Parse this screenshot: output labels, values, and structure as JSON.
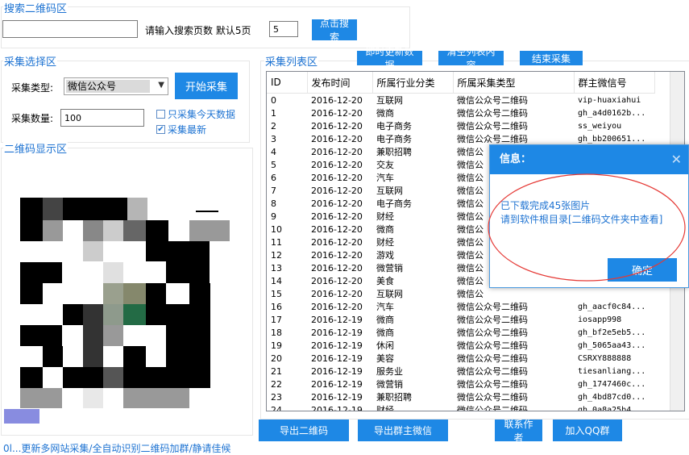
{
  "search_group": {
    "legend": "搜索二维码区",
    "page_hint": "请输入搜索页数 默认5页",
    "pages_value": "5",
    "query_value": "",
    "search_button": "点击搜索"
  },
  "collect_group": {
    "legend": "采集选择区",
    "type_label": "采集类型:",
    "type_value": "微信公众号",
    "start_button": "开始采集",
    "count_label": "采集数量:",
    "count_value": "100",
    "only_today_label": "只采集今天数据",
    "only_today_checked": false,
    "latest_label": "采集最新",
    "latest_checked": true
  },
  "qr_group": {
    "legend": "二维码显示区"
  },
  "list_group": {
    "legend": "采集列表区",
    "buttons": {
      "refresh": "即时更新数据",
      "clear": "清空列表内容",
      "stop": "结束采集"
    },
    "columns": [
      "ID",
      "发布时间",
      "所属行业分类",
      "所属采集类型",
      "群主微信号"
    ],
    "rows": [
      [
        "0",
        "2016-12-20",
        "互联网",
        "微信公众号二维码",
        "vip-huaxiahui"
      ],
      [
        "1",
        "2016-12-20",
        "微商",
        "微信公众号二维码",
        "gh_a4d0162b..."
      ],
      [
        "2",
        "2016-12-20",
        "电子商务",
        "微信公众号二维码",
        "ss_weiyou"
      ],
      [
        "3",
        "2016-12-20",
        "电子商务",
        "微信公众号二维码",
        "gh_bb200651..."
      ],
      [
        "4",
        "2016-12-20",
        "兼职招聘",
        "微信公",
        ""
      ],
      [
        "5",
        "2016-12-20",
        "交友",
        "微信公",
        ""
      ],
      [
        "6",
        "2016-12-20",
        "汽车",
        "微信公",
        ""
      ],
      [
        "7",
        "2016-12-20",
        "互联网",
        "微信公",
        ""
      ],
      [
        "8",
        "2016-12-20",
        "电子商务",
        "微信公",
        ""
      ],
      [
        "9",
        "2016-12-20",
        "财经",
        "微信公",
        ""
      ],
      [
        "10",
        "2016-12-20",
        "微商",
        "微信公",
        ""
      ],
      [
        "11",
        "2016-12-20",
        "财经",
        "微信公",
        ""
      ],
      [
        "12",
        "2016-12-20",
        "游戏",
        "微信公",
        ""
      ],
      [
        "13",
        "2016-12-20",
        "微营销",
        "微信公",
        ""
      ],
      [
        "14",
        "2016-12-20",
        "美食",
        "微信公",
        ""
      ],
      [
        "15",
        "2016-12-20",
        "互联网",
        "微信公",
        ""
      ],
      [
        "16",
        "2016-12-20",
        "汽车",
        "微信公众号二维码",
        "gh_aacf0c84..."
      ],
      [
        "17",
        "2016-12-19",
        "微商",
        "微信公众号二维码",
        "iosapp998"
      ],
      [
        "18",
        "2016-12-19",
        "微商",
        "微信公众号二维码",
        "gh_bf2e5eb5..."
      ],
      [
        "19",
        "2016-12-19",
        "休闲",
        "微信公众号二维码",
        "gh_5065aa43..."
      ],
      [
        "20",
        "2016-12-19",
        "美容",
        "微信公众号二维码",
        "CSRXY888888"
      ],
      [
        "21",
        "2016-12-19",
        "服务业",
        "微信公众号二维码",
        "tiesanliang..."
      ],
      [
        "22",
        "2016-12-19",
        "微营销",
        "微信公众号二维码",
        "gh_1747460c..."
      ],
      [
        "23",
        "2016-12-19",
        "兼职招聘",
        "微信公众号二维码",
        "gh_4bd87cd0..."
      ],
      [
        "24",
        "2016-12-19",
        "财经",
        "微信公众号二维码",
        "gh_0a8a25b4..."
      ]
    ]
  },
  "bottom_buttons": {
    "export_qr": "导出二维码",
    "export_wechat": "导出群主微信",
    "contact": "联系作者",
    "join_qq": "加入QQ群"
  },
  "status_text": "0l...更新多网站采集/全自动识别二维码加群/静请佳候",
  "dialog": {
    "title": "信息：",
    "close_icon": "close-icon",
    "line1": "已下载完成45张图片",
    "line2": "请到软件根目录[二维码文件夹中查看]",
    "ok_button": "确定"
  },
  "colors": {
    "accent": "#1e88e5",
    "legend_text": "#1e73d2",
    "annotation_circle": "#e53935"
  }
}
